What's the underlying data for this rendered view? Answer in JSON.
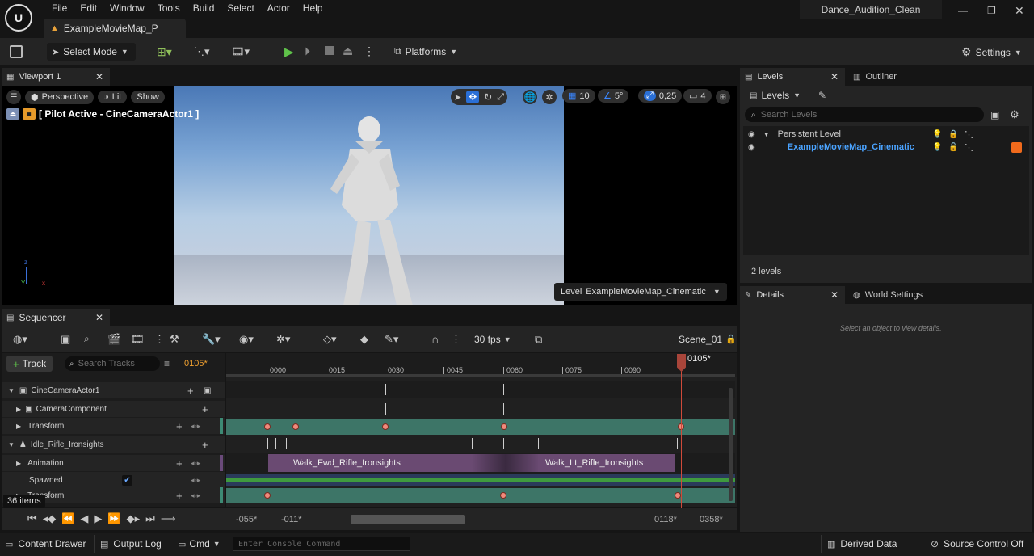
{
  "menu": [
    "File",
    "Edit",
    "Window",
    "Tools",
    "Build",
    "Select",
    "Actor",
    "Help"
  ],
  "project_name": "Dance_Audition_Clean",
  "map_tab": "ExampleMovieMap_P",
  "toolbar": {
    "select_mode": "Select Mode",
    "platforms": "Platforms",
    "settings": "Settings"
  },
  "viewport": {
    "tab": "Viewport 1",
    "perspective": "Perspective",
    "lit": "Lit",
    "show": "Show",
    "pilot": "[ Pilot Active - CineCameraActor1 ]",
    "grid": "10",
    "angle": "5°",
    "scale": "0,25",
    "camera_speed": "4",
    "level_label": "Level",
    "level_name": "ExampleMovieMap_Cinematic"
  },
  "levels_panel": {
    "tab": "Levels",
    "outliner_tab": "Outliner",
    "levels_dropdown": "Levels",
    "search_placeholder": "Search Levels",
    "persistent": "Persistent Level",
    "cinematic": "ExampleMovieMap_Cinematic",
    "count": "2 levels",
    "accent": "#f06a1c"
  },
  "details_panel": {
    "tab": "Details",
    "world_settings_tab": "World Settings",
    "empty_text": "Select an object to view details."
  },
  "sequencer": {
    "tab": "Sequencer",
    "fps": "30 fps",
    "scene": "Scene_01",
    "track_button": "Track",
    "search_placeholder": "Search Tracks",
    "current_frame": "0105*",
    "playhead_label": "0105*",
    "ruler": [
      "0000",
      "0015",
      "0030",
      "0045",
      "0060",
      "0075",
      "0090"
    ],
    "tracks": {
      "camera_actor": "CineCameraActor1",
      "camera_component": "CameraComponent",
      "transform1": "Transform",
      "idle": "Idle_Rifle_Ironsights",
      "animation": "Animation",
      "spawned": "Spawned",
      "transform2": "Transform"
    },
    "clips": [
      "Walk_Fwd_Rifle_Ironsights",
      "Walk_Lt_Rifle_Ironsights"
    ],
    "items_count": "36 items",
    "range_start": "-055*",
    "view_start": "-011*",
    "view_end": "0118*",
    "range_end": "0358*"
  },
  "statusbar": {
    "content_drawer": "Content Drawer",
    "output_log": "Output Log",
    "cmd": "Cmd",
    "console_placeholder": "Enter Console Command",
    "derived_data": "Derived Data",
    "source_control": "Source Control Off"
  }
}
